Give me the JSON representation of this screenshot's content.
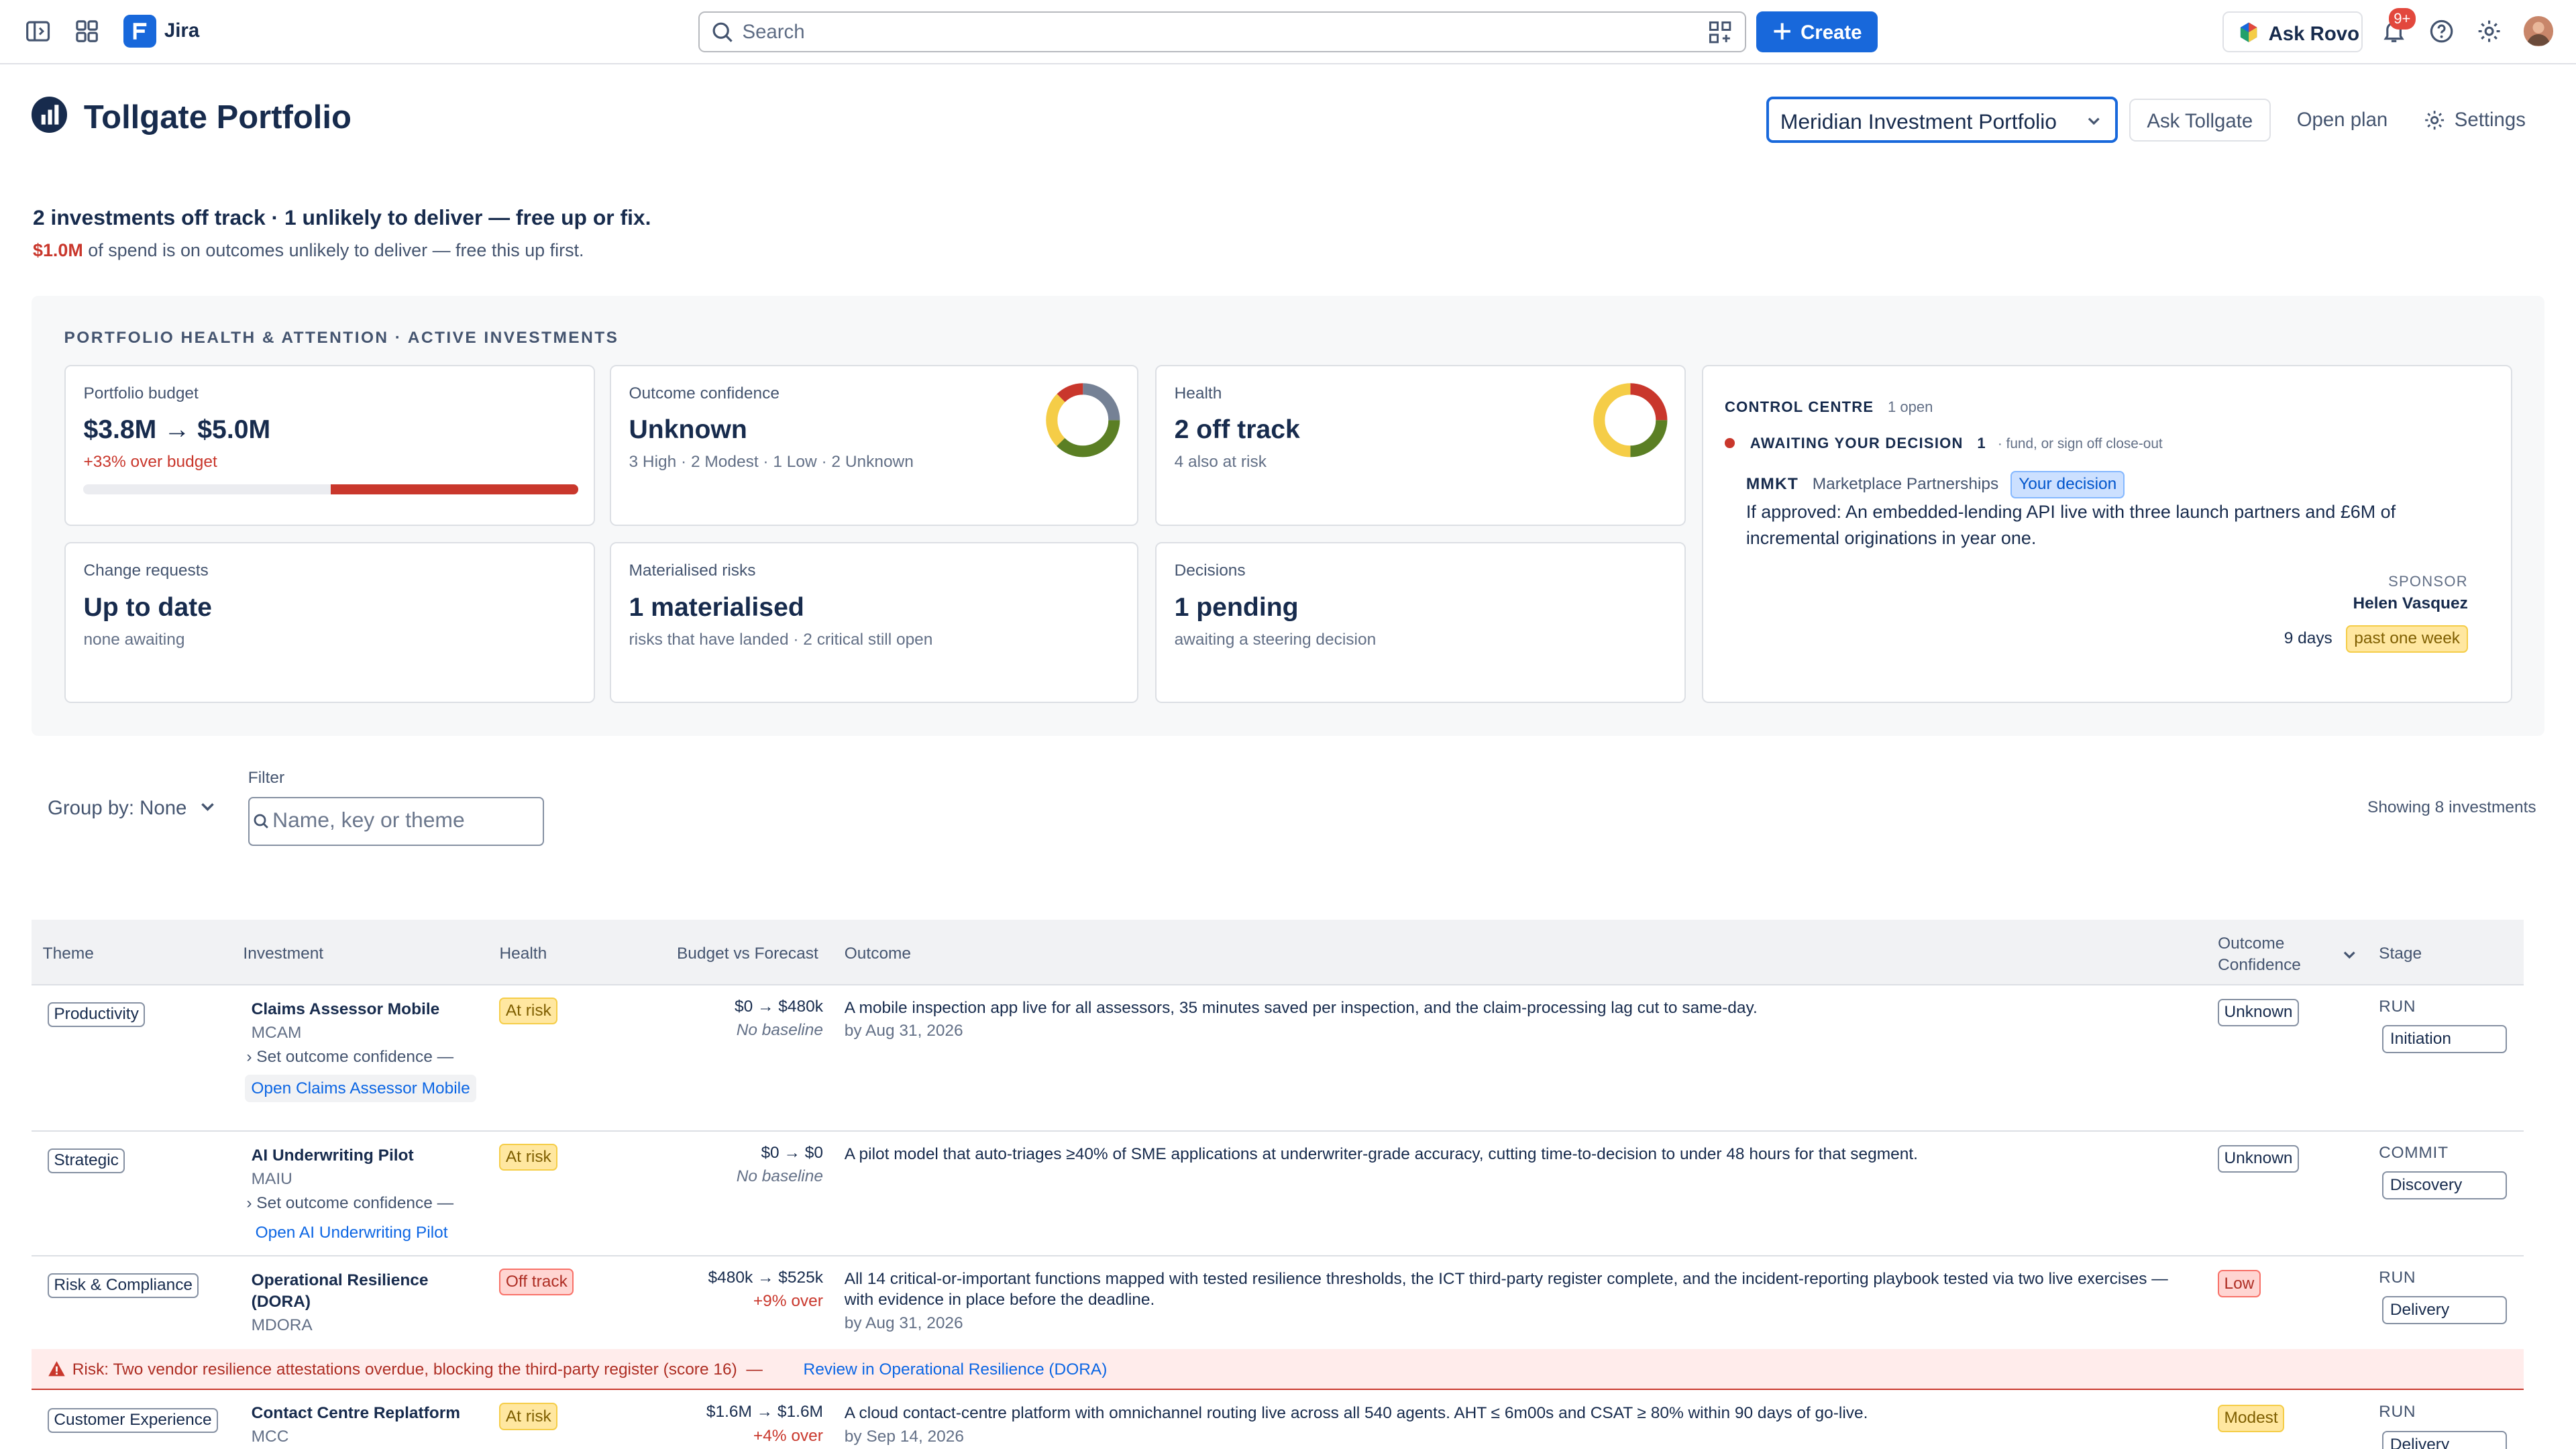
{
  "app": {
    "name": "Jira"
  },
  "search": {
    "placeholder": "Search"
  },
  "topbar": {
    "create_label": "Create",
    "rovo_label": "Ask Rovo",
    "notifications_count": "9+"
  },
  "page": {
    "title": "Tollgate Portfolio"
  },
  "header_actions": {
    "portfolio_selected": "Meridian Investment Portfolio",
    "ask_label": "Ask Tollgate",
    "open_plan_label": "Open plan",
    "settings_label": "Settings"
  },
  "summary": {
    "headline": "2 investments off track · 1 unlikely to deliver — free up or fix.",
    "sub_amount": "$1.0M",
    "sub_text": " of spend is on outcomes unlikely to deliver — free this up first."
  },
  "health_panel": {
    "title": "PORTFOLIO HEALTH & ATTENTION · ACTIVE INVESTMENTS",
    "cards": {
      "budget": {
        "label": "Portfolio budget",
        "value": "$3.8M → $5.0M",
        "sub": "+33% over budget",
        "progress_baseline_fraction": 0.5,
        "progress_over_fraction": 0.5
      },
      "confidence": {
        "label": "Outcome confidence",
        "value": "Unknown",
        "sub": "3 High · 2 Modest · 1 Low · 2 Unknown"
      },
      "health": {
        "label": "Health",
        "value": "2 off track",
        "sub": "4 also at risk"
      },
      "change": {
        "label": "Change requests",
        "value": "Up to date",
        "sub": "none awaiting"
      },
      "risks": {
        "label": "Materialised risks",
        "value": "1 materialised",
        "sub": "risks that have landed · 2 critical still open"
      },
      "decisions": {
        "label": "Decisions",
        "value": "1 pending",
        "sub": "awaiting a steering decision"
      }
    },
    "control_centre": {
      "title": "CONTROL CENTRE",
      "open_count": "1 open",
      "awaiting_label": "AWAITING YOUR DECISION",
      "awaiting_count": "1",
      "awaiting_hint": "· fund, or sign off close-out",
      "item_key": "MMKT",
      "item_name": "Marketplace Partnerships",
      "item_tag": "Your decision",
      "item_text": "If approved: An embedded-lending API live with three launch partners and £6M of incremental originations in year one.",
      "sponsor_label": "SPONSOR",
      "sponsor_name": "Helen Vasquez",
      "age": "9 days",
      "age_tag": "past one week"
    }
  },
  "controls": {
    "group_by": "Group by: None",
    "filter_label": "Filter",
    "filter_placeholder": "Name, key or theme",
    "showing": "Showing 8 investments"
  },
  "table": {
    "headers": {
      "theme": "Theme",
      "investment": "Investment",
      "health": "Health",
      "budget": "Budget vs Forecast",
      "outcome": "Outcome",
      "confidence_1": "Outcome",
      "confidence_2": "Confidence",
      "stage": "Stage"
    },
    "rows": [
      {
        "theme": "Productivity",
        "name": "Claims Assessor Mobile",
        "key": "MCAM",
        "set_conf": "Set outcome confidence —",
        "open": "Open Claims Assessor Mobile",
        "health": "At risk",
        "budget": "$0 → $480k",
        "budget_note": "No baseline",
        "outcome": "A mobile inspection app live for all assessors, 35 minutes saved per inspection, and the claim-processing lag cut to same-day.",
        "by": "by Aug 31, 2026",
        "confidence": "Unknown",
        "phase": "RUN",
        "stage": "Initiation"
      },
      {
        "theme": "Strategic",
        "name": "AI Underwriting Pilot",
        "key": "MAIU",
        "set_conf": "Set outcome confidence —",
        "open": "Open AI Underwriting Pilot",
        "health": "At risk",
        "budget": "$0 → $0",
        "budget_note": "No baseline",
        "outcome": "A pilot model that auto-triages ≥40% of SME applications at underwriter-grade accuracy, cutting time-to-decision to under 48 hours for that segment.",
        "confidence": "Unknown",
        "phase": "COMMIT",
        "stage": "Discovery"
      },
      {
        "theme": "Risk & Compliance",
        "name": "Operational Resilience (DORA)",
        "key": "MDORA",
        "health": "Off track",
        "budget": "$480k → $525k",
        "budget_note": "+9% over",
        "outcome": "All 14 critical-or-important functions mapped with tested resilience thresholds, the ICT third-party register complete, and the incident-reporting playbook tested via two live exercises — with evidence in place before the deadline.",
        "by": "by Aug 31, 2026",
        "confidence": "Low",
        "phase": "RUN",
        "stage": "Delivery"
      },
      {
        "theme": "Customer Experience",
        "name": "Contact Centre Replatform",
        "key": "MCC",
        "health": "At risk",
        "budget": "$1.6M → $1.6M",
        "budget_note": "+4% over",
        "outcome": "A cloud contact-centre platform with omnichannel routing live across all 540 agents. AHT ≤ 6m00s and CSAT ≥ 80% within 90 days of go-live.",
        "by": "by Sep 14, 2026",
        "confidence": "Modest",
        "phase": "RUN",
        "stage": "Delivery"
      }
    ],
    "risk_banner": {
      "text": "Risk: Two vendor resilience attestations overdue, blocking the third-party register (score 16)  —",
      "link": "Review in Operational Resilience (DORA)"
    }
  },
  "colors": {
    "brand": "#1868db",
    "danger": "#c9372c",
    "warning": "#f5cd47"
  }
}
